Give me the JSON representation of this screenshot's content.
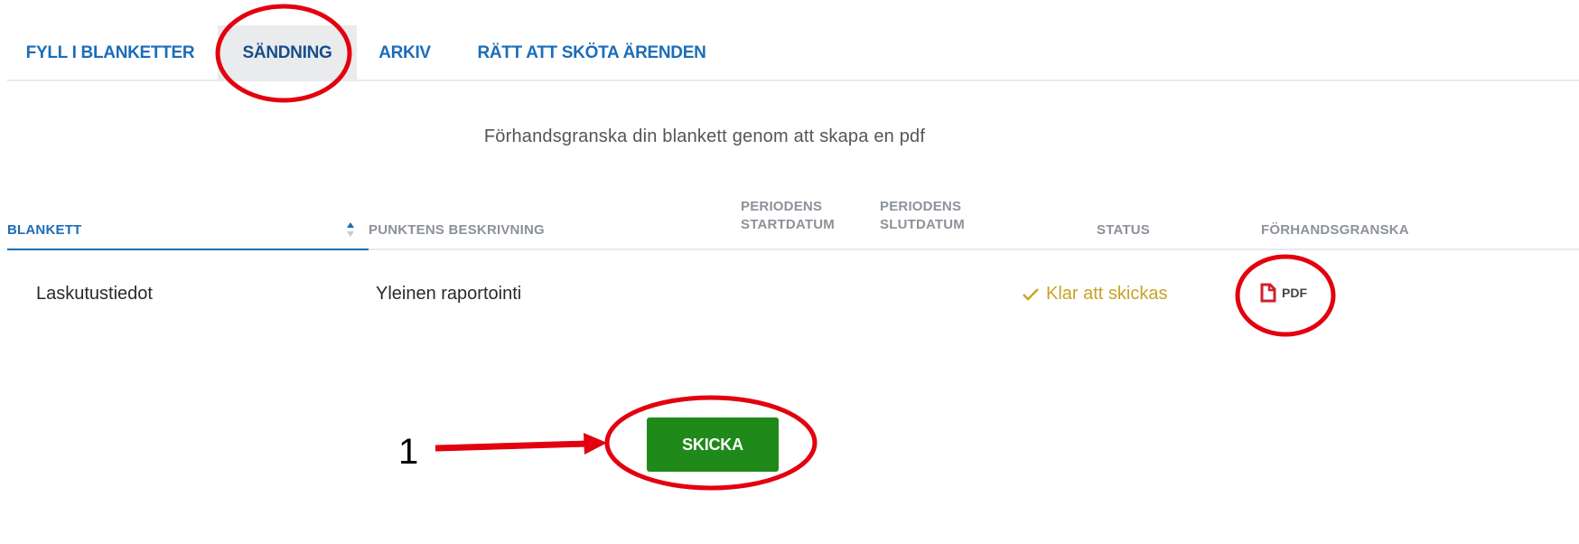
{
  "tabs": [
    {
      "label": "FYLL I BLANKETTER",
      "active": false
    },
    {
      "label": "SÄNDNING",
      "active": true
    },
    {
      "label": "ARKIV",
      "active": false
    },
    {
      "label": "RÄTT ATT SKÖTA ÄRENDEN",
      "active": false
    }
  ],
  "subtitle": "Förhandsgranska din blankett genom att skapa en pdf",
  "table": {
    "headers": {
      "blankett": "BLANKETT",
      "beskrivning": "PUNKTENS BESKRIVNING",
      "startdatum_1": "PERIODENS",
      "startdatum_2": "STARTDATUM",
      "slutdatum_1": "PERIODENS",
      "slutdatum_2": "SLUTDATUM",
      "status": "STATUS",
      "forhandsgranska": "FÖRHANDSGRANSKA"
    },
    "rows": [
      {
        "blankett": "Laskutustiedot",
        "beskrivning": "Yleinen raportointi",
        "startdatum": "",
        "slutdatum": "",
        "status": "Klar att skickas",
        "preview": "PDF"
      }
    ]
  },
  "send_button": "SKICKA",
  "annotation": {
    "callout_number": "1"
  },
  "colors": {
    "tab_text": "#1b6db8",
    "active_tab_bg": "#e9ebed",
    "status_ready": "#c9a227",
    "pdf_icon": "#d0202c",
    "send_button": "#1f8a1a",
    "annotation": "#e3000f"
  },
  "icons": {
    "sort": "sort-icon",
    "status": "check-icon",
    "preview": "pdf-file-icon"
  }
}
